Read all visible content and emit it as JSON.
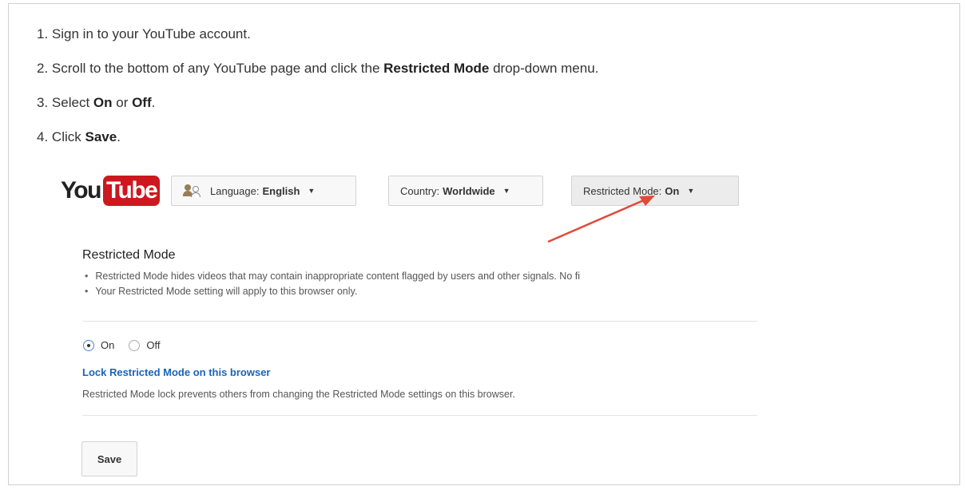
{
  "steps": [
    {
      "num": "1.",
      "text_before": "Sign in to your YouTube account.",
      "bold": "",
      "text_after": ""
    },
    {
      "num": "2.",
      "text_before": "Scroll to the bottom of any YouTube page and click the ",
      "bold": "Restricted Mode",
      "text_after": " drop-down menu."
    },
    {
      "num": "3.",
      "text_before": "Select ",
      "bold": "On",
      "middle": " or ",
      "bold2": "Off",
      "text_after": "."
    },
    {
      "num": "4.",
      "text_before": "Click ",
      "bold": "Save",
      "text_after": "."
    }
  ],
  "logo": {
    "you": "You",
    "tube": "Tube"
  },
  "footer_buttons": {
    "language": {
      "label": "Language: ",
      "value": "English",
      "icon": "people-icon"
    },
    "country": {
      "label": "Country: ",
      "value": "Worldwide"
    },
    "restricted": {
      "label": "Restricted Mode: ",
      "value": "On"
    }
  },
  "panel": {
    "title": "Restricted Mode",
    "bullets": [
      "Restricted Mode hides videos that may contain inappropriate content flagged by users and other signals. No fi",
      "Your Restricted Mode setting will apply to this browser only."
    ],
    "radio_on": "On",
    "radio_off": "Off",
    "selected": "On",
    "lock_link": "Lock Restricted Mode on this browser",
    "lock_desc": "Restricted Mode lock prevents others from changing the Restricted Mode settings on this browser.",
    "save": "Save"
  },
  "colors": {
    "youtube_red": "#cc181e",
    "link_blue": "#1a65b8",
    "arrow_red": "#e04a3a"
  }
}
